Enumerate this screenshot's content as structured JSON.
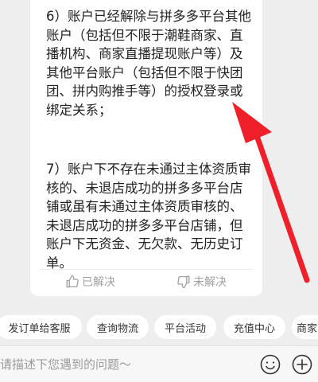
{
  "answer": {
    "item6": "6）账户已经解除与拼多多平台其他账户（包括但不限于潮鞋商家、直播机构、商家直播提现账户等）及其他平台账户（包括但不限于快团团、拼内购推手等）的授权登录或绑定关系；",
    "item7": "7）账户下不存在未通过主体资质审核的、未退店成功的拼多多平台店铺或虽有未通过主体资质审核的、未退店成功的拼多多平台店铺，但账户下无资金、无欠款、无历史订单。"
  },
  "feedback": {
    "resolved_label": "已解决",
    "unresolved_label": "未解决"
  },
  "quick_replies": [
    "发订单给客服",
    "查询物流",
    "平台活动",
    "充值中心",
    "商家"
  ],
  "input": {
    "placeholder": "请描述下您遇到的问题～"
  },
  "icons": {
    "resolved": "thumbs-up-icon",
    "unresolved": "thumbs-down-icon",
    "emoji": "emoji-icon",
    "plus": "plus-icon"
  },
  "colors": {
    "background": "#eeeeee",
    "card": "#ffffff",
    "annotation_arrow": "#f0202a",
    "muted_text": "#a0a0a0"
  }
}
